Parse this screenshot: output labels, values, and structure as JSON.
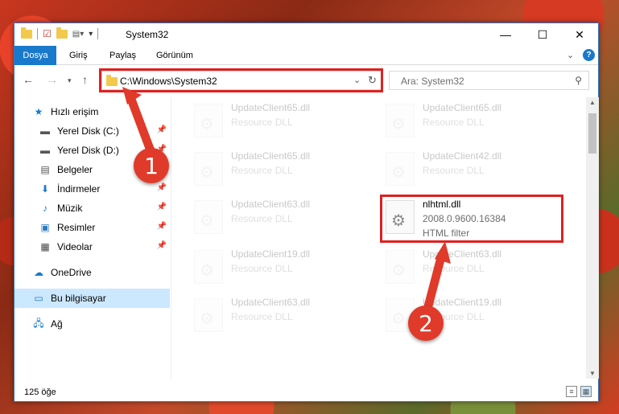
{
  "window": {
    "title": "System32",
    "controls": {
      "minimize": "—",
      "maximize": "☐",
      "close": "✕"
    }
  },
  "ribbon": {
    "tabs": [
      "Dosya",
      "Giriş",
      "Paylaş",
      "Görünüm"
    ]
  },
  "address": {
    "path": "C:\\Windows\\System32",
    "search_placeholder": "Ara: System32"
  },
  "sidebar": {
    "items": [
      {
        "label": "Hızlı erişim",
        "icon": "star-icon"
      },
      {
        "label": "Yerel Disk (C:)",
        "icon": "drive-icon",
        "pinned": true
      },
      {
        "label": "Yerel Disk (D:)",
        "icon": "drive-icon",
        "pinned": true
      },
      {
        "label": "Belgeler",
        "icon": "documents-icon",
        "pinned": true
      },
      {
        "label": "İndirmeler",
        "icon": "download-icon",
        "pinned": true
      },
      {
        "label": "Müzik",
        "icon": "music-icon",
        "pinned": true
      },
      {
        "label": "Resimler",
        "icon": "pictures-icon",
        "pinned": true
      },
      {
        "label": "Videolar",
        "icon": "videos-icon",
        "pinned": true
      },
      {
        "label": "OneDrive",
        "icon": "cloud-icon"
      },
      {
        "label": "Bu bilgisayar",
        "icon": "computer-icon",
        "selected": true
      },
      {
        "label": "Ağ",
        "icon": "network-icon"
      }
    ]
  },
  "files": [
    {
      "name": "UpdateClient65.dll",
      "l2": "Resource DLL",
      "l3": "",
      "faded": true
    },
    {
      "name": "UpdateClient65.dll",
      "l2": "Resource DLL",
      "l3": "",
      "faded": true
    },
    {
      "name": "UpdateClient65.dll",
      "l2": "Resource DLL",
      "l3": "",
      "faded": true
    },
    {
      "name": "UpdateClient42.dll",
      "l2": "Resource DLL",
      "l3": "",
      "faded": true
    },
    {
      "name": "UpdateClient63.dll",
      "l2": "Resource DLL",
      "l3": "",
      "faded": true
    },
    {
      "name": "nlhtml.dll",
      "l2": "2008.0.9600.16384",
      "l3": "HTML filter",
      "faded": false
    },
    {
      "name": "UpdateClient19.dll",
      "l2": "Resource DLL",
      "l3": "",
      "faded": true
    },
    {
      "name": "UpdateClient63.dll",
      "l2": "Resource DLL",
      "l3": "",
      "faded": true
    },
    {
      "name": "UpdateClient63.dll",
      "l2": "Resource DLL",
      "l3": "",
      "faded": true
    },
    {
      "name": "UpdateClient19.dll",
      "l2": "Resource DLL",
      "l3": "",
      "faded": true
    }
  ],
  "status": {
    "count": "125 öğe"
  },
  "annotations": {
    "badge1": "1",
    "badge2": "2",
    "accent": "#e02020"
  }
}
